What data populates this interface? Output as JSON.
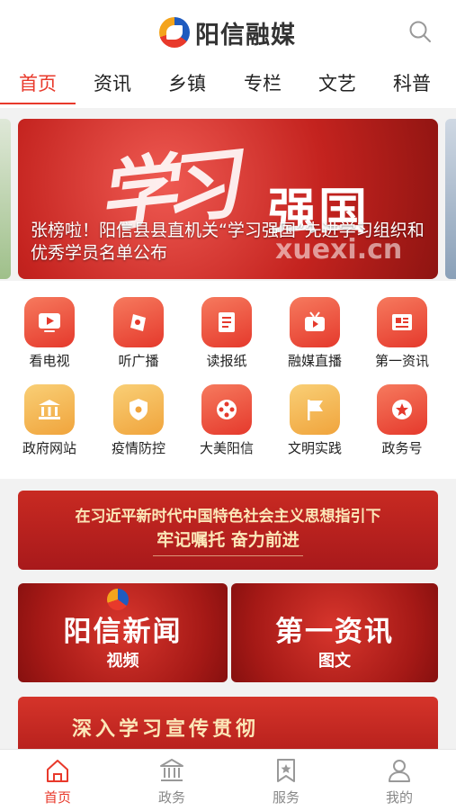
{
  "app": {
    "title": "阳信融媒"
  },
  "tabs": [
    {
      "label": "首页",
      "active": true
    },
    {
      "label": "资讯"
    },
    {
      "label": "乡镇"
    },
    {
      "label": "专栏"
    },
    {
      "label": "文艺"
    },
    {
      "label": "科普"
    }
  ],
  "banner": {
    "calligraphy": "学习",
    "headline_art": "强国",
    "site": "xuexi.cn",
    "caption": "张榜啦！阳信县县直机关“学习强国”先进学习组织和优秀学员名单公布"
  },
  "grid": [
    {
      "label": "看电视",
      "icon": "tv-play-icon",
      "color": "red"
    },
    {
      "label": "听广播",
      "icon": "radio-icon",
      "color": "red"
    },
    {
      "label": "读报纸",
      "icon": "newspaper-icon",
      "color": "red"
    },
    {
      "label": "融媒直播",
      "icon": "live-tv-icon",
      "color": "red"
    },
    {
      "label": "第一资讯",
      "icon": "news-icon",
      "color": "red"
    },
    {
      "label": "政府网站",
      "icon": "government-building-icon",
      "color": "gold"
    },
    {
      "label": "疫情防控",
      "icon": "shield-virus-icon",
      "color": "gold"
    },
    {
      "label": "大美阳信",
      "icon": "film-reel-icon",
      "color": "red"
    },
    {
      "label": "文明实践",
      "icon": "flag-icon",
      "color": "gold"
    },
    {
      "label": "政务号",
      "icon": "star-badge-icon",
      "color": "red"
    }
  ],
  "section_banner": {
    "line1": "在习近平新时代中国特色社会主义思想指引下",
    "line2": "牢记嘱托 奋力前进"
  },
  "cards": [
    {
      "title": "阳信新闻",
      "subtitle": "视频"
    },
    {
      "title": "第一资讯",
      "subtitle": "图文"
    }
  ],
  "section_banner2": {
    "line1": "深入学习宣传贯彻"
  },
  "bottom_nav": [
    {
      "label": "首页",
      "icon": "home-icon",
      "active": true
    },
    {
      "label": "政务",
      "icon": "government-building-icon"
    },
    {
      "label": "服务",
      "icon": "bookmark-star-icon"
    },
    {
      "label": "我的",
      "icon": "user-icon"
    }
  ],
  "colors": {
    "accent": "#e8392b",
    "banner_red": "#c4231f",
    "gold": "#f0a43c"
  }
}
